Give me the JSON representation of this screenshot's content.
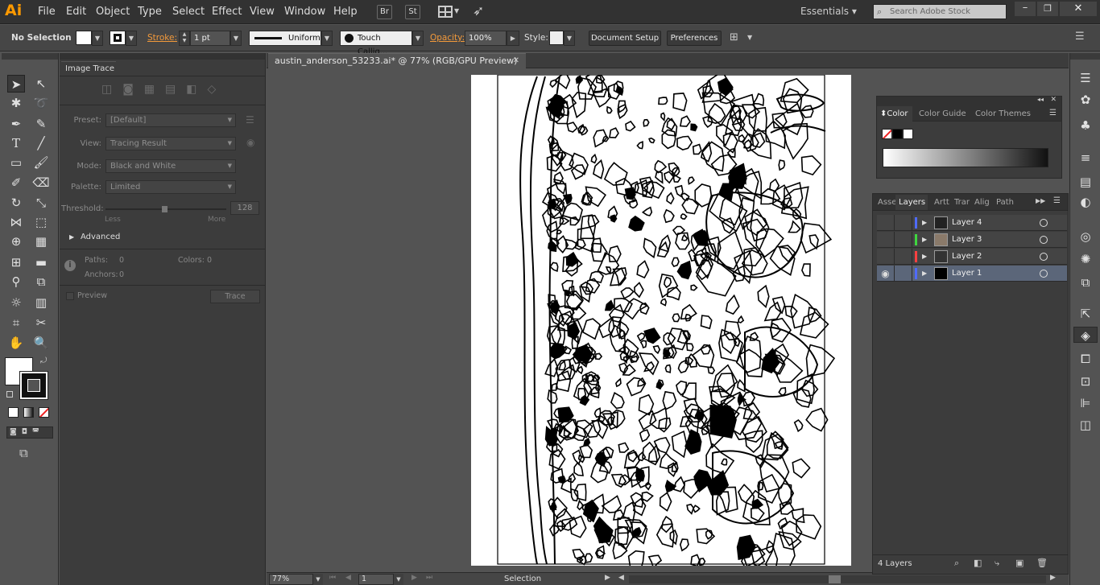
{
  "app": {
    "logo": "Ai",
    "workspace": "Essentials",
    "search_placeholder": "Search Adobe Stock",
    "bridge": "Br",
    "stock": "St"
  },
  "menu": [
    "File",
    "Edit",
    "Object",
    "Type",
    "Select",
    "Effect",
    "View",
    "Window",
    "Help"
  ],
  "control": {
    "selection": "No Selection",
    "stroke_label": "Stroke:",
    "stroke_weight": "1 pt",
    "profile": "Uniform",
    "brush": "Touch Callig...",
    "opacity_label": "Opacity:",
    "opacity": "100%",
    "style_label": "Style:",
    "document_setup": "Document Setup",
    "preferences": "Preferences"
  },
  "image_trace": {
    "title": "Image Trace",
    "preset_label": "Preset:",
    "preset": "[Default]",
    "view_label": "View:",
    "view": "Tracing Result",
    "mode_label": "Mode:",
    "mode": "Black and White",
    "palette_label": "Palette:",
    "palette": "Limited",
    "threshold_label": "Threshold:",
    "threshold": "128",
    "less": "Less",
    "more": "More",
    "advanced": "Advanced",
    "paths_label": "Paths:",
    "paths": "0",
    "colors_label": "Colors:",
    "colors": "0",
    "anchors_label": "Anchors:",
    "anchors": "0",
    "preview": "Preview",
    "trace": "Trace"
  },
  "document": {
    "tab": "austin_anderson_53233.ai* @ 77% (RGB/GPU Preview)"
  },
  "status": {
    "zoom": "77%",
    "page": "1",
    "tool": "Selection"
  },
  "color_panel": {
    "tabs": [
      "Color",
      "Color Guide",
      "Color Themes"
    ]
  },
  "layers_panel": {
    "tabs": [
      "Asse",
      "Layers",
      "Artt",
      "Trar",
      "Alig",
      "Path"
    ],
    "layers": [
      {
        "name": "Layer 4",
        "color": "#4f6bff",
        "visible": false,
        "active": false
      },
      {
        "name": "Layer 3",
        "color": "#3fd63f",
        "visible": false,
        "active": false
      },
      {
        "name": "Layer 2",
        "color": "#ff4040",
        "visible": false,
        "active": false
      },
      {
        "name": "Layer 1",
        "color": "#4f6bff",
        "visible": true,
        "active": true
      }
    ],
    "count": "4 Layers"
  }
}
